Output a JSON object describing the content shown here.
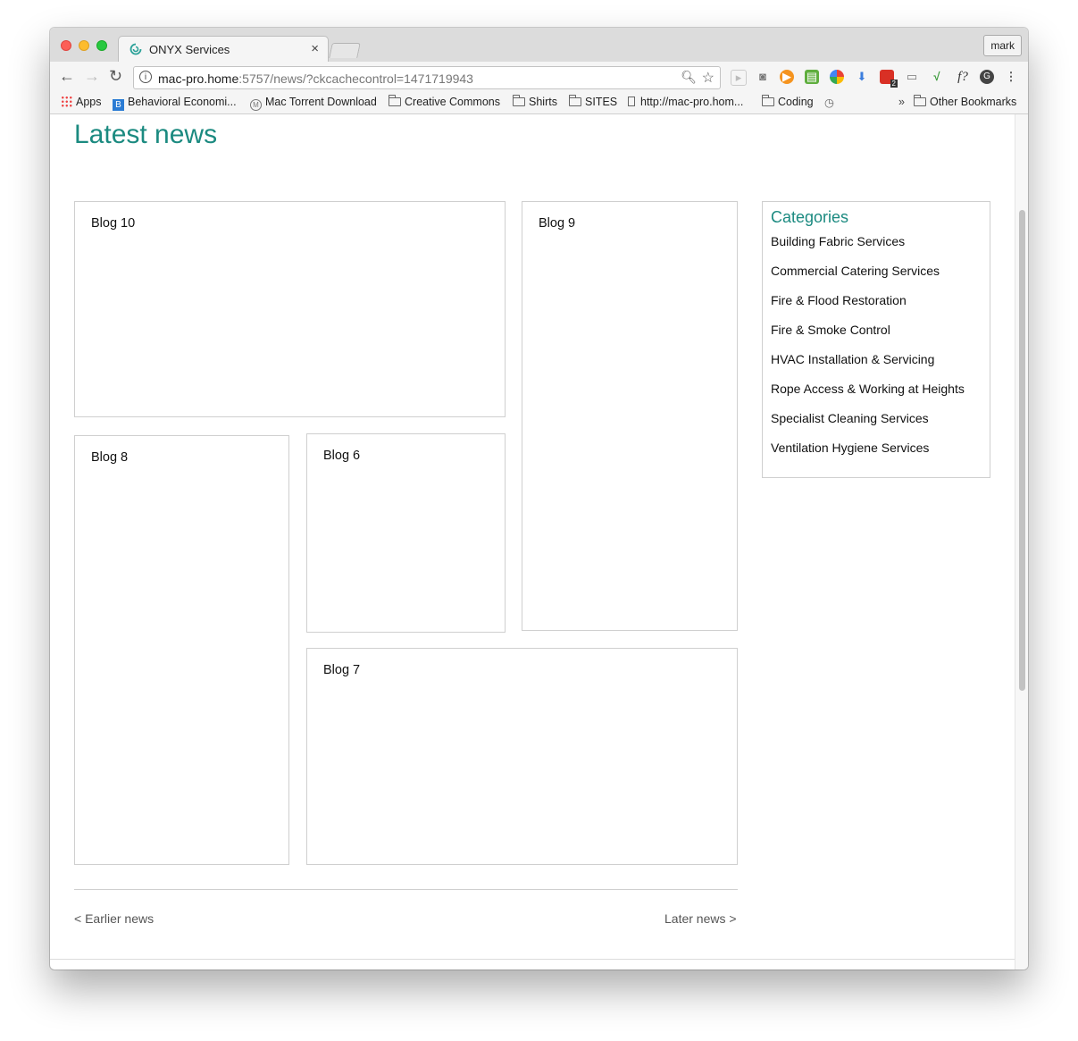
{
  "browser": {
    "tab_title": "ONYX Services",
    "tab_close": "×",
    "profile_name": "mark",
    "url_host": "mac-pro.home",
    "url_rest": ":5757/news/?ckcachecontrol=1471719943",
    "info_glyph": "i",
    "extension_badge": "2",
    "extension_f_label": "f?"
  },
  "bookmarks": {
    "items": [
      "Apps",
      "Behavioral Economi...",
      "Mac Torrent Download",
      "Creative Commons",
      "Shirts",
      "SITES",
      "http://mac-pro.hom...",
      "Coding"
    ],
    "overflow": "»",
    "other": "Other Bookmarks"
  },
  "page": {
    "title": "Latest news",
    "posts": [
      "Blog 10",
      "Blog 9",
      "Blog 8",
      "Blog 6",
      "Blog 7"
    ],
    "categories": {
      "heading": "Categories",
      "items": [
        "Building Fabric Services",
        "Commercial Catering Services",
        "Fire & Flood Restoration",
        "Fire & Smoke Control",
        "HVAC Installation & Servicing",
        "Rope Access & Working at Heights",
        "Specialist Cleaning Services",
        "Ventilation Hygiene Services"
      ]
    },
    "pager": {
      "earlier": "< Earlier news",
      "later": "Later news >"
    }
  },
  "colors": {
    "accent": "#1b8a80",
    "border": "#cfcfcf"
  }
}
